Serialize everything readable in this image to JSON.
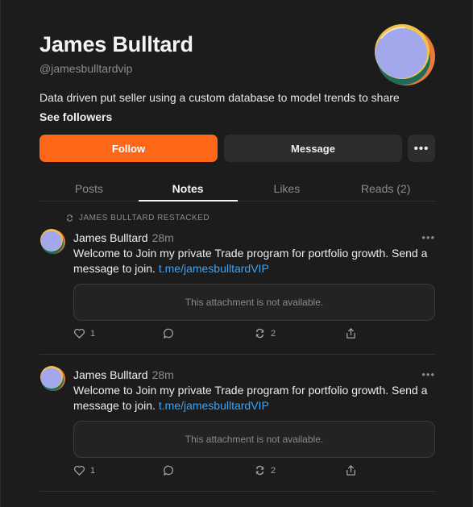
{
  "profile": {
    "name": "James Bulltard",
    "handle": "@jamesbulltardvip",
    "bio": "Data driven put seller using a custom database to model trends to share",
    "see_followers": "See followers"
  },
  "buttons": {
    "follow": "Follow",
    "message": "Message",
    "more": "•••"
  },
  "tabs": [
    {
      "label": "Posts",
      "active": false
    },
    {
      "label": "Notes",
      "active": true
    },
    {
      "label": "Likes",
      "active": false
    },
    {
      "label": "Reads (2)",
      "active": false
    }
  ],
  "notes": [
    {
      "restack_label": "JAMES BULLTARD RESTACKED",
      "author": "James Bulltard",
      "time": "28m",
      "more": "•••",
      "text": "Welcome to Join my private Trade program for portfolio growth. Send a message to join. ",
      "link": "t.me/jamesbulltardVIP",
      "attachment": "This attachment is not available.",
      "likes": "1",
      "comments": "",
      "restacks": "2"
    },
    {
      "restack_label": "",
      "author": "James Bulltard",
      "time": "28m",
      "more": "•••",
      "text": "Welcome to Join my private Trade program for portfolio growth. Send a message to join. ",
      "link": "t.me/jamesbulltardVIP",
      "attachment": "This attachment is not available.",
      "likes": "1",
      "comments": "",
      "restacks": "2"
    }
  ],
  "colors": {
    "accent": "#ff6719",
    "link": "#3ea3f2",
    "background": "#1c1c1c"
  },
  "icons": {
    "restack": "restack-icon",
    "like": "heart-icon",
    "comment": "comment-icon",
    "restack_action": "restack-icon",
    "share": "share-icon"
  }
}
